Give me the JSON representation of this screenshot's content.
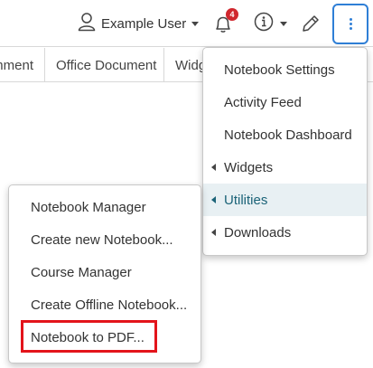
{
  "header": {
    "user_name": "Example User",
    "notification_count": "4",
    "icons": {
      "user": "user-icon",
      "bell": "bell-icon",
      "info": "info-icon",
      "pen": "pen-icon",
      "kebab": "vertical-ellipsis-icon"
    },
    "accent_color": "#2f7fd6",
    "badge_color": "#d0272e"
  },
  "tabs": [
    {
      "label": "hment"
    },
    {
      "label": "Office Document"
    },
    {
      "label": "Widg"
    }
  ],
  "settings_menu": {
    "items": [
      {
        "label": "Notebook Settings"
      },
      {
        "label": "Activity Feed"
      },
      {
        "label": "Notebook Dashboard"
      },
      {
        "label": "Widgets",
        "submenu": true
      },
      {
        "label": "Utilities",
        "submenu": true,
        "active": true
      },
      {
        "label": "Downloads",
        "submenu": true
      }
    ]
  },
  "utilities_menu": {
    "items": [
      {
        "label": "Notebook Manager"
      },
      {
        "label": "Create new Notebook..."
      },
      {
        "label": "Course Manager"
      },
      {
        "label": "Create Offline Notebook..."
      },
      {
        "label": "Notebook to PDF...",
        "highlighted": true
      }
    ],
    "highlight_color": "#e3141b"
  }
}
